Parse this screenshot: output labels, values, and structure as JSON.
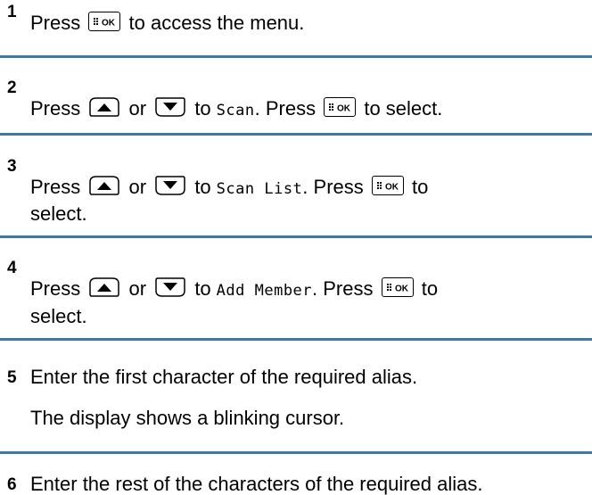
{
  "steps": [
    {
      "number": "1",
      "parts": {
        "a": "Press",
        "b": "to access the menu."
      }
    },
    {
      "number": "2",
      "parts": {
        "a": "Press",
        "or": "or",
        "to": "to",
        "screen": "Scan",
        "press": ". Press",
        "end": "to select."
      }
    },
    {
      "number": "3",
      "parts": {
        "a": "Press",
        "or": "or",
        "to": "to",
        "screen": "Scan List",
        "press": ". Press",
        "end": "to",
        "cont": "select."
      }
    },
    {
      "number": "4",
      "parts": {
        "a": "Press",
        "or": "or",
        "to": "to",
        "screen": "Add Member",
        "press": ". Press",
        "end": "to",
        "cont": "select."
      }
    },
    {
      "number": "5",
      "text": "Enter the first character of the required alias.",
      "result": "The display shows a blinking cursor."
    },
    {
      "number": "6",
      "text": "Enter the rest of the characters of the required alias."
    }
  ],
  "keys": {
    "ok": "menu-ok-key",
    "up": "up-arrow-key",
    "down": "down-arrow-key",
    "ok_label": "OK"
  },
  "colors": {
    "separator": "#3f7aa6",
    "text": "#000000"
  }
}
